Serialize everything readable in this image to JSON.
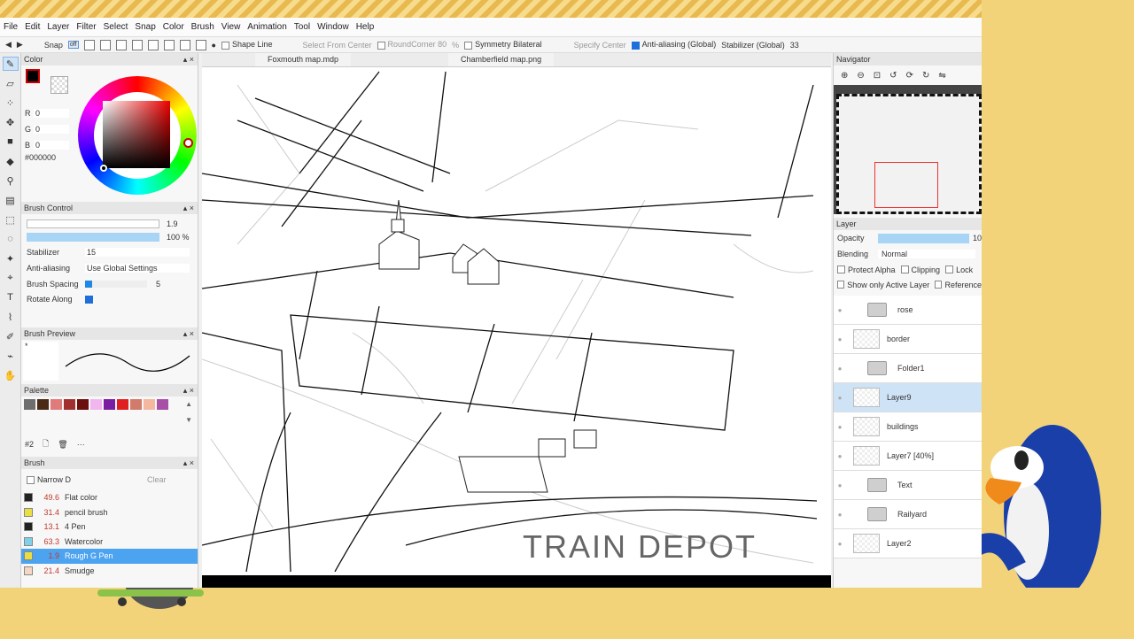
{
  "menu": [
    "File",
    "Edit",
    "Layer",
    "Filter",
    "Select",
    "Snap",
    "Color",
    "Brush",
    "View",
    "Animation",
    "Tool",
    "Window",
    "Help"
  ],
  "toolbar": {
    "snap": "Snap",
    "snap_state": "off",
    "shape_line": "Shape Line",
    "select_center": "Select From Center",
    "roundcorner": "RoundCorner 80",
    "percent": "%",
    "symmetry": "Symmetry Bilateral",
    "specify_center": "Specify Center",
    "antialias": "Anti-aliasing (Global)",
    "stabilizer": "Stabilizer (Global)",
    "stabilizer_val": "33"
  },
  "color": {
    "title": "Color",
    "r_label": "R",
    "g_label": "G",
    "b_label": "B",
    "r": "0",
    "g": "0",
    "b": "0",
    "hex": "#000000"
  },
  "brush_control": {
    "title": "Brush Control",
    "size": "1.9",
    "opacity": "100 %",
    "stabilizer_label": "Stabilizer",
    "stabilizer": "15",
    "aa_label": "Anti-aliasing",
    "aa": "Use Global Settings",
    "spacing_label": "Brush Spacing",
    "spacing": "5",
    "rotate_label": "Rotate Along"
  },
  "brush_preview": {
    "title": "Brush Preview",
    "star": "*"
  },
  "palette": {
    "title": "Palette",
    "name": "#2",
    "colors": [
      "#6e6e6e",
      "#4a2a14",
      "#e07b7b",
      "#a03030",
      "#6b0f0f",
      "#f2b6ef",
      "#7b1fa2",
      "#e02020",
      "#d07b6b",
      "#f4b8a0",
      "#a850a8"
    ]
  },
  "brush": {
    "title": "Brush",
    "filter": "Narrow D",
    "clear": "Clear",
    "items": [
      {
        "size": "49.6",
        "name": "Flat color",
        "color": "#222222"
      },
      {
        "size": "31.4",
        "name": "pencil brush",
        "color": "#e8e040"
      },
      {
        "size": "13.1",
        "name": "4 Pen",
        "color": "#222222"
      },
      {
        "size": "63.3",
        "name": "Watercolor",
        "color": "#7fd0e8"
      },
      {
        "size": "1.9",
        "name": "Rough G Pen",
        "color": "#e8e040"
      },
      {
        "size": "21.4",
        "name": "Smudge",
        "color": "#f4d8c4"
      }
    ]
  },
  "tabs": [
    "Foxmouth map.mdp",
    "Chamberfield map.png"
  ],
  "canvas": {
    "label": "TRAIN DEPOT"
  },
  "navigator": {
    "title": "Navigator"
  },
  "layer": {
    "title": "Layer",
    "opacity_label": "Opacity",
    "opacity": "10",
    "blending_label": "Blending",
    "blending": "Normal",
    "protect_alpha": "Protect Alpha",
    "clipping": "Clipping",
    "lock": "Lock",
    "show_active": "Show only Active Layer",
    "reference": "Reference",
    "items": [
      {
        "name": "rose",
        "type": "folder"
      },
      {
        "name": "border",
        "type": "layer"
      },
      {
        "name": "Folder1",
        "type": "folder"
      },
      {
        "name": "Layer9",
        "type": "layer",
        "selected": true
      },
      {
        "name": "buildings",
        "type": "layer"
      },
      {
        "name": "Layer7 [40%]",
        "type": "layer"
      },
      {
        "name": "Text",
        "type": "folder"
      },
      {
        "name": "Railyard",
        "type": "folder"
      },
      {
        "name": "Layer2",
        "type": "layer"
      }
    ]
  }
}
